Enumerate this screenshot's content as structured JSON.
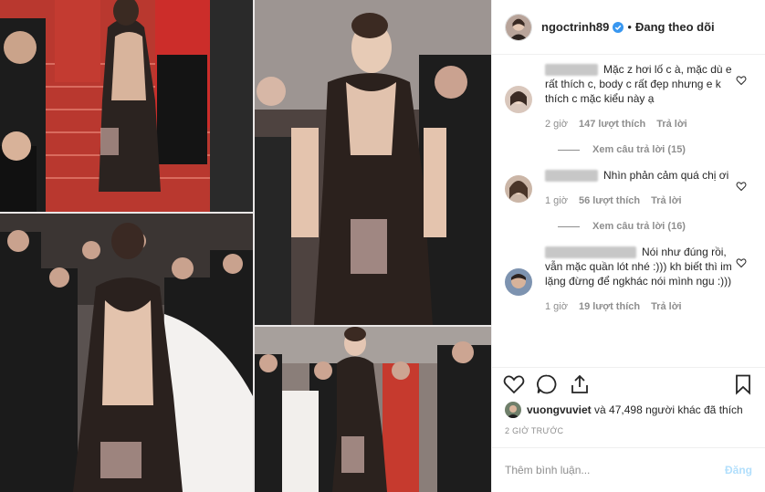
{
  "post": {
    "username": "ngoctrinh89",
    "separator": "•",
    "follow_label": "Đang theo dõi",
    "verified_icon": "verified-badge-icon"
  },
  "comments": [
    {
      "text": "Mặc z hơi lố c à, mặc dù e rất thích c, body c rất đẹp nhưng e k thích c mặc kiểu này ạ",
      "time": "2 giờ",
      "likes": "147 lượt thích",
      "reply_label": "Trả lời",
      "view_replies": "Xem câu trả lời (15)"
    },
    {
      "text": "Nhìn phản cảm quá chị ơi",
      "time": "1 giờ",
      "likes": "56 lượt thích",
      "reply_label": "Trả lời",
      "view_replies": "Xem câu trả lời (16)"
    },
    {
      "text": "Nói như đúng rồi, vẫn mặc quần lót nhé :))) kh biết thì im lặng đừng để ngkhác nói mình ngu :)))",
      "time": "1 giờ",
      "likes": "19 lượt thích",
      "reply_label": "Trả lời"
    }
  ],
  "likes": {
    "user": "vuongvuviet",
    "rest": "và 47,498 người khác đã thích"
  },
  "time_ago": "2 GIỜ TRƯỚC",
  "add_comment": {
    "placeholder": "Thêm bình luận...",
    "post_label": "Đăng"
  },
  "colors": {
    "carpet": "#c0392b",
    "accent_blue": "#3897f0",
    "post_disabled": "#b2dffc",
    "muted_text": "#8e8e8e"
  }
}
